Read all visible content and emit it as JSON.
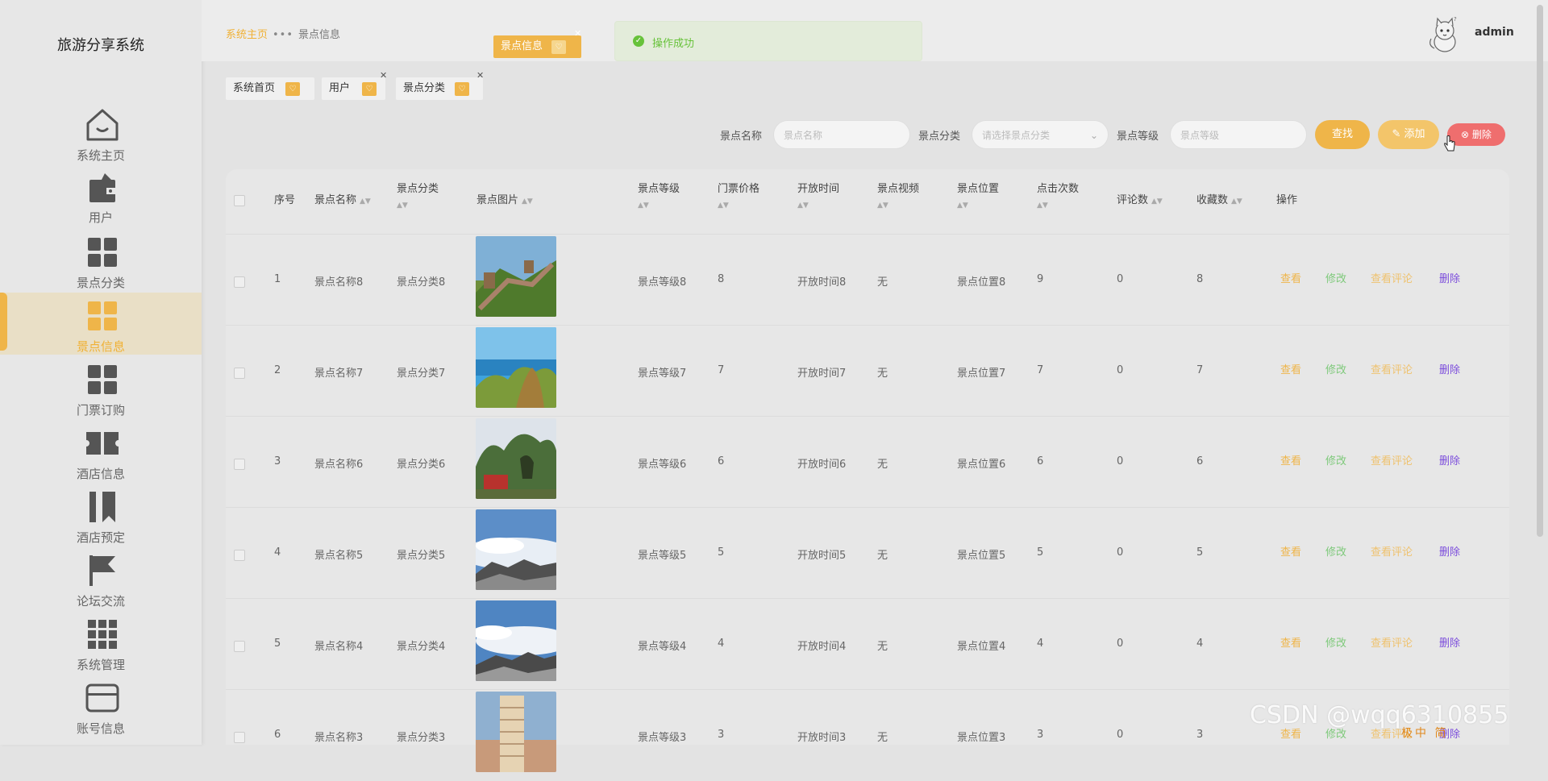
{
  "sidebar": {
    "title": "旅游分享系统",
    "items": [
      {
        "label": "系统主页",
        "icon": "home-icon"
      },
      {
        "label": "用户",
        "icon": "wallet-icon"
      },
      {
        "label": "景点分类",
        "icon": "grid-icon"
      },
      {
        "label": "景点信息",
        "icon": "grid-icon"
      },
      {
        "label": "门票订购",
        "icon": "grid-icon"
      },
      {
        "label": "酒店信息",
        "icon": "ticket-icon"
      },
      {
        "label": "酒店预定",
        "icon": "book-icon"
      },
      {
        "label": "论坛交流",
        "icon": "flag-icon"
      },
      {
        "label": "系统管理",
        "icon": "apps-icon"
      },
      {
        "label": "账号信息",
        "icon": "card-icon"
      }
    ],
    "active_item": "景点信息"
  },
  "header": {
    "breadcrumb_home": "系统主页",
    "breadcrumb_sep": "•••",
    "breadcrumb_current": "景点信息",
    "username": "admin"
  },
  "toast": {
    "message": "操作成功"
  },
  "tabs": [
    {
      "label": "系统首页"
    },
    {
      "label": "用户"
    },
    {
      "label": "景点分类"
    },
    {
      "label": "景点信息"
    }
  ],
  "search": {
    "name_label": "景点名称",
    "name_placeholder": "景点名称",
    "category_label": "景点分类",
    "category_placeholder": "请选择景点分类",
    "level_label": "景点等级",
    "level_placeholder": "景点等级",
    "find_button": "查找",
    "add_button": "添加",
    "delete_button": "删除"
  },
  "table": {
    "headers": {
      "index": "序号",
      "name": "景点名称",
      "category": "景点分类",
      "image": "景点图片",
      "level": "景点等级",
      "price": "门票价格",
      "open_time": "开放时间",
      "video": "景点视频",
      "location": "景点位置",
      "clicks": "点击次数",
      "comments": "评论数",
      "favorites": "收藏数",
      "actions": "操作"
    },
    "actions": {
      "view": "查看",
      "edit": "修改",
      "view_comments": "查看评论",
      "delete": "删除"
    },
    "rows": [
      {
        "index": "1",
        "name": "景点名称8",
        "category": "景点分类8",
        "level": "景点等级8",
        "price": "8",
        "open_time": "开放时间8",
        "video": "无",
        "location": "景点位置8",
        "clicks": "9",
        "comments": "0",
        "favorites": "8"
      },
      {
        "index": "2",
        "name": "景点名称7",
        "category": "景点分类7",
        "level": "景点等级7",
        "price": "7",
        "open_time": "开放时间7",
        "video": "无",
        "location": "景点位置7",
        "clicks": "7",
        "comments": "0",
        "favorites": "7"
      },
      {
        "index": "3",
        "name": "景点名称6",
        "category": "景点分类6",
        "level": "景点等级6",
        "price": "6",
        "open_time": "开放时间6",
        "video": "无",
        "location": "景点位置6",
        "clicks": "6",
        "comments": "0",
        "favorites": "6"
      },
      {
        "index": "4",
        "name": "景点名称5",
        "category": "景点分类5",
        "level": "景点等级5",
        "price": "5",
        "open_time": "开放时间5",
        "video": "无",
        "location": "景点位置5",
        "clicks": "5",
        "comments": "0",
        "favorites": "5"
      },
      {
        "index": "5",
        "name": "景点名称4",
        "category": "景点分类4",
        "level": "景点等级4",
        "price": "4",
        "open_time": "开放时间4",
        "video": "无",
        "location": "景点位置4",
        "clicks": "4",
        "comments": "0",
        "favorites": "4"
      },
      {
        "index": "6",
        "name": "景点名称3",
        "category": "景点分类3",
        "level": "景点等级3",
        "price": "3",
        "open_time": "开放时间3",
        "video": "无",
        "location": "景点位置3",
        "clicks": "3",
        "comments": "0",
        "favorites": "3"
      }
    ]
  },
  "watermark": "CSDN @wqq6310855",
  "ime_bar": "极中 简"
}
